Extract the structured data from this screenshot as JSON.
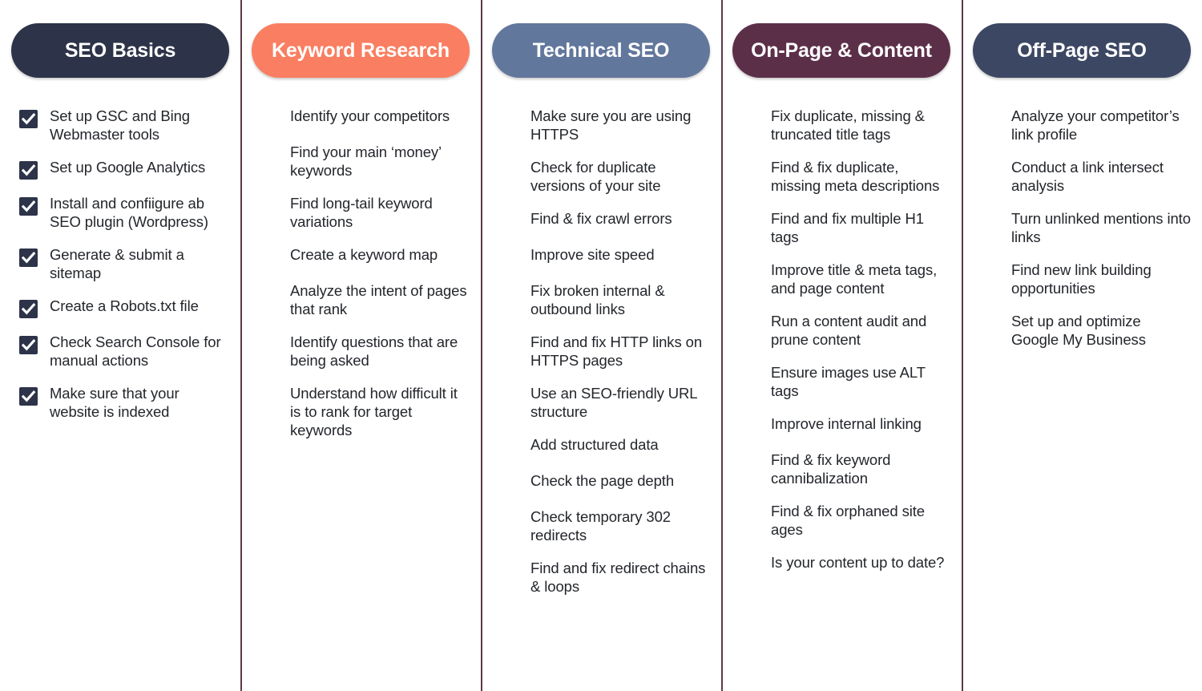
{
  "meta": {
    "check_icon": "checkbox-checked-icon"
  },
  "columns": [
    {
      "key": "seo-basics",
      "title": "SEO Basics",
      "color": "#2d3348",
      "items": [
        "Set up GSC and Bing Webmaster tools",
        "Set up Google Analytics",
        "Install and confiigure ab SEO plugin (Wordpress)",
        "Generate & submit a sitemap",
        "Create a Robots.txt file",
        "Check Search Console for manual actions",
        "Make sure that your website is indexed"
      ]
    },
    {
      "key": "keyword-research",
      "title": "Keyword Research",
      "color": "#fa7e61",
      "items": [
        "Identify your competitors",
        "Find your main ‘money’ keywords",
        "Find long-tail keyword variations",
        "Create a keyword map",
        "Analyze the intent of pages that rank",
        "Identify questions that are being asked",
        "Understand how difficult it is to rank for target keywords"
      ]
    },
    {
      "key": "technical-seo",
      "title": "Technical SEO",
      "color": "#62779c",
      "items": [
        "Make sure you are using HTTPS",
        "Check for duplicate versions of your site",
        "Find & fix crawl errors",
        "Improve site speed",
        "Fix broken internal & outbound links",
        "Find and fix HTTP links on HTTPS pages",
        "Use an SEO-friendly URL structure",
        "Add structured data",
        "Check the page depth",
        "Check temporary 302 redirects",
        "Find and fix redirect chains & loops"
      ]
    },
    {
      "key": "on-page-content",
      "title": "On-Page & Content",
      "color": "#5c2f49",
      "items": [
        "Fix duplicate, missing & truncated title tags",
        "Find & fix duplicate, missing meta descriptions",
        "Find and fix multiple H1 tags",
        "Improve title & meta tags, and page content",
        "Run a content audit and prune content",
        "Ensure images use ALT tags",
        "Improve internal linking",
        "Find & fix keyword cannibalization",
        "Find & fix orphaned site ages",
        "Is your content up to date?"
      ]
    },
    {
      "key": "off-page-seo",
      "title": "Off-Page SEO",
      "color": "#3c4763",
      "items": [
        "Analyze your competitor’s link profile",
        "Conduct a link intersect analysis",
        "Turn unlinked mentions into links",
        "Find new link building opportunities",
        "Set up and optimize Google My Business"
      ]
    }
  ]
}
